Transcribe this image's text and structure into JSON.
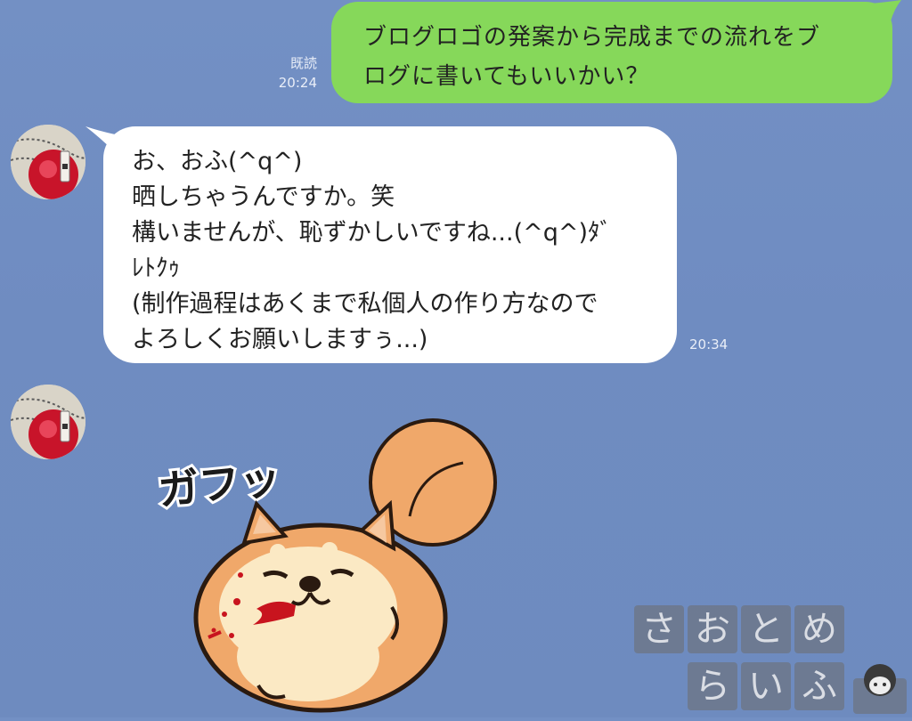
{
  "chat": {
    "messages": [
      {
        "sender": "self",
        "lines": [
          "ブログロゴの発案から完成までの流れをブ",
          "ログに書いてもいいかい？"
        ],
        "read_label": "既読",
        "time": "20:24"
      },
      {
        "sender": "other",
        "lines": [
          "お、おふ(^q^)",
          "晒しちゃうんですか。笑",
          "構いませんが、恥ずかしいですね...(^q^)ﾀﾞ",
          "ﾚﾄｸｩ",
          "(制作過程はあくまで私個人の作り方なので",
          "よろしくお願いしますぅ...)"
        ],
        "time": "20:34"
      }
    ],
    "sticker": {
      "text": "ガフッ",
      "icon": "shiba-dog-sticker"
    }
  },
  "watermark": {
    "chars": [
      "さ",
      "お",
      "と",
      "め",
      "ら",
      "い",
      "ふ"
    ]
  },
  "colors": {
    "background": "#7390c4",
    "sent_bubble": "#86d85a",
    "received_bubble": "#ffffff"
  }
}
